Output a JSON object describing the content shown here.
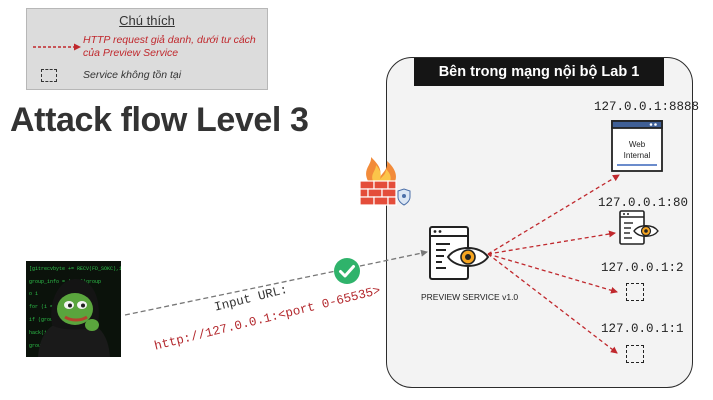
{
  "legend": {
    "title": "Chú thích",
    "http_desc": "HTTP request giả danh, dưới tư cách của Preview Service",
    "missing_desc": "Service không tồn tại"
  },
  "title": "Attack flow Level 3",
  "panel": {
    "title": "Bên trong mạng nội bộ Lab 1"
  },
  "services": [
    {
      "address": "127.0.0.1:8888",
      "icon": "web-internal-icon",
      "label": "Web Internal",
      "exists": true
    },
    {
      "address": "127.0.0.1:80",
      "icon": "service-monitor-icon",
      "exists": true
    },
    {
      "address": "127.0.0.1:2",
      "icon": "missing-service-box",
      "exists": false
    },
    {
      "address": "127.0.0.1:1",
      "icon": "missing-service-box",
      "exists": false
    }
  ],
  "preview_service": {
    "label": "PREVIEW SERVICE v1.0",
    "icon": "preview-service-icon"
  },
  "request": {
    "input_label": "Input URL:",
    "url": "http://127.0.0.1:<port 0-65535>"
  },
  "colors": {
    "attack": "#c0282d",
    "check": "#2fb36b",
    "panel_header": "#151515",
    "firewall": "#e44d3a"
  }
}
